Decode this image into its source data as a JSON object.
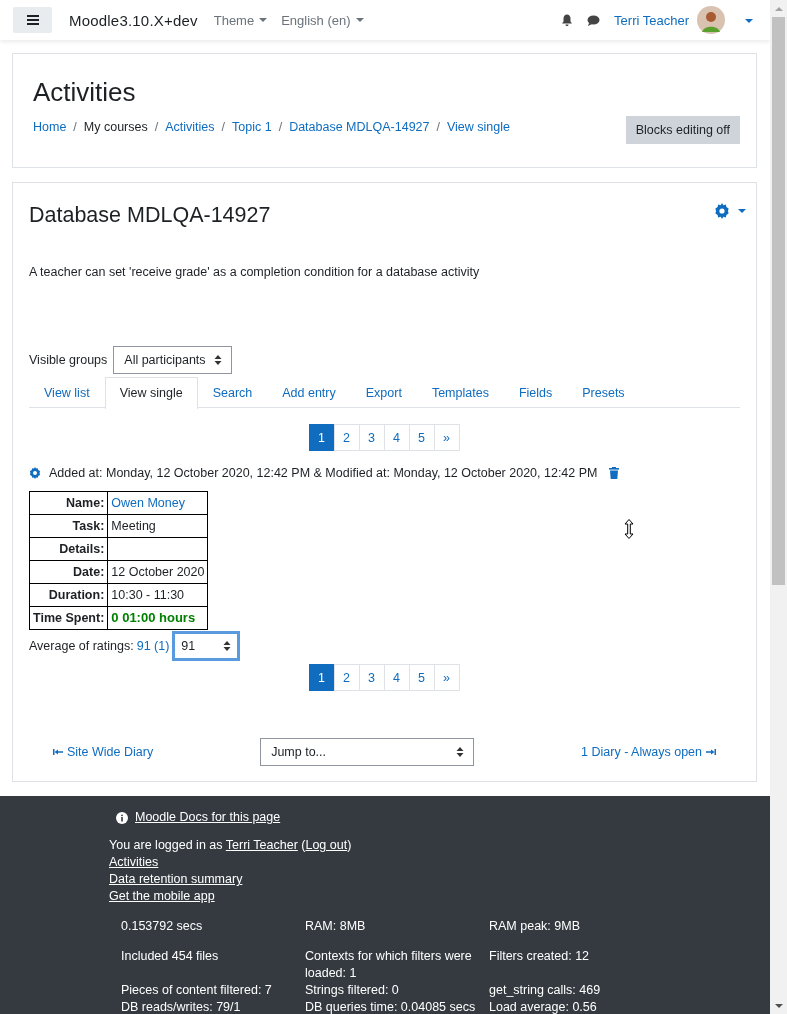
{
  "navbar": {
    "site_name": "Moodle3.10.X+dev",
    "menus": [
      {
        "label": "Theme"
      },
      {
        "label": "English (en)"
      }
    ],
    "user": "Terri Teacher"
  },
  "page_header": {
    "title": "Activities",
    "breadcrumb": [
      {
        "label": "Home",
        "link": true
      },
      {
        "separator": "/",
        "label": "My courses",
        "link": false
      },
      {
        "separator": "/",
        "label": "Activities",
        "link": true
      },
      {
        "separator": "/",
        "label": "Topic 1",
        "link": true
      },
      {
        "separator": "/",
        "label": "Database MDLQA-14927",
        "link": true
      },
      {
        "separator": "/",
        "label": "View single",
        "link": true
      }
    ],
    "button": "Blocks editing off"
  },
  "activity": {
    "title": "Database MDLQA-14927",
    "description": "A teacher can set 'receive grade' as a completion condition for a database activity",
    "groups": {
      "label": "Visible groups",
      "value": "All participants"
    },
    "tabs": [
      {
        "label": "View list",
        "selected": false
      },
      {
        "label": "View single",
        "selected": true
      },
      {
        "label": "Search",
        "selected": false
      },
      {
        "label": "Add entry",
        "selected": false
      },
      {
        "label": "Export",
        "selected": false
      },
      {
        "label": "Templates",
        "selected": false
      },
      {
        "label": "Fields",
        "selected": false
      },
      {
        "label": "Presets",
        "selected": false
      }
    ],
    "pagination_top": [
      {
        "label": "1",
        "selected": true
      },
      {
        "label": "2",
        "selected": false
      },
      {
        "label": "3",
        "selected": false
      },
      {
        "label": "4",
        "selected": false
      },
      {
        "label": "5",
        "selected": false
      },
      {
        "label": "»",
        "selected": false
      }
    ],
    "entry_meta": "Added at: Monday, 12 October 2020, 12:42 PM & Modified at: Monday, 12 October 2020, 12:42 PM",
    "fields": [
      {
        "label": "Name:",
        "value": "Owen Money",
        "kind": "link"
      },
      {
        "label": "Task:",
        "value": "Meeting",
        "kind": "text"
      },
      {
        "label": "Details:",
        "kind": "text"
      },
      {
        "label": "Date:",
        "value": "12 October 2020",
        "kind": "text"
      },
      {
        "label": "Duration:",
        "value": "10:30 - 11:30",
        "kind": "text"
      },
      {
        "label": "Time Spent:",
        "value": "0 01:00 hours",
        "kind": "highlight"
      }
    ],
    "rating": {
      "label": "Average of ratings:",
      "average": "91 (1)",
      "value": "91",
      "focused": true
    },
    "pagination_bottom": [
      {
        "label": "1",
        "selected": true
      },
      {
        "label": "2",
        "selected": false
      },
      {
        "label": "3",
        "selected": false
      },
      {
        "label": "4",
        "selected": false
      },
      {
        "label": "5",
        "selected": false
      },
      {
        "label": "»",
        "selected": false
      }
    ],
    "nav": {
      "previous": "Site Wide Diary",
      "jump": "Jump to...",
      "next": "1 Diary - Always open"
    }
  },
  "footer": {
    "docs_link": "Moodle Docs for this page",
    "login": {
      "prefix": "You are logged in as ",
      "user": "Terri Teacher",
      "before_logout": " (",
      "logout": "Log out",
      "after_logout": ")"
    },
    "links": [
      "Activities",
      "Data retention summary",
      "Get the mobile app"
    ],
    "stats": [
      [
        "0.153792 secs",
        "RAM: 8MB",
        "RAM peak: 9MB"
      ],
      [
        "Included 454 files",
        "Contexts for which filters were loaded: 1",
        "Filters created: 12"
      ],
      [
        "Pieces of content filtered: 7",
        "Strings filtered: 0",
        "get_string calls: 469"
      ],
      [
        "DB reads/writes: 79/1",
        "DB queries time: 0.04085 secs",
        "Load average: 0.56"
      ]
    ]
  }
}
